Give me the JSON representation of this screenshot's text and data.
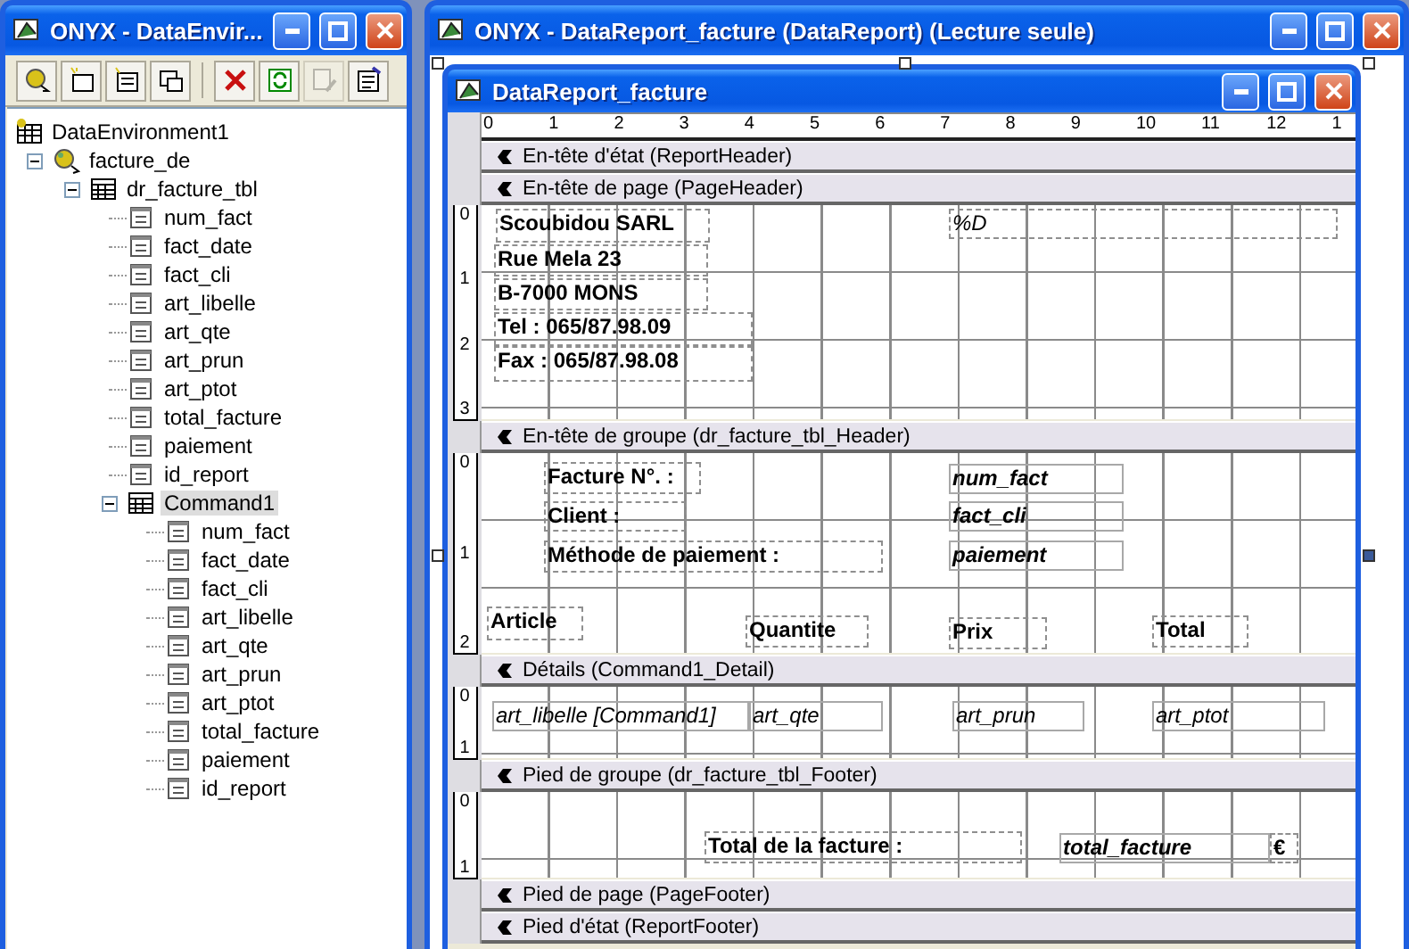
{
  "explorer": {
    "title": "ONYX - DataEnvir...",
    "toolbar": [
      {
        "kind": "connection",
        "disabled": false
      },
      {
        "kind": "command",
        "disabled": false
      },
      {
        "kind": "procedure",
        "disabled": false
      },
      {
        "kind": "child",
        "disabled": false
      },
      {
        "kind": "delete",
        "disabled": false
      },
      {
        "kind": "refresh",
        "disabled": false
      },
      {
        "kind": "design",
        "disabled": true
      },
      {
        "kind": "properties",
        "disabled": false
      }
    ],
    "tree": [
      {
        "label": "DataEnvironment1",
        "kind": "environment",
        "selected": false,
        "children": [
          {
            "label": "facture_de",
            "kind": "connection",
            "selected": false,
            "expanded": true,
            "children": [
              {
                "label": "dr_facture_tbl",
                "kind": "command",
                "selected": false,
                "expanded": true,
                "children": [
                  {
                    "label": "num_fact",
                    "kind": "field",
                    "selected": false
                  },
                  {
                    "label": "fact_date",
                    "kind": "field",
                    "selected": false
                  },
                  {
                    "label": "fact_cli",
                    "kind": "field",
                    "selected": false
                  },
                  {
                    "label": "art_libelle",
                    "kind": "field",
                    "selected": false
                  },
                  {
                    "label": "art_qte",
                    "kind": "field",
                    "selected": false
                  },
                  {
                    "label": "art_prun",
                    "kind": "field",
                    "selected": false
                  },
                  {
                    "label": "art_ptot",
                    "kind": "field",
                    "selected": false
                  },
                  {
                    "label": "total_facture",
                    "kind": "field",
                    "selected": false
                  },
                  {
                    "label": "paiement",
                    "kind": "field",
                    "selected": false
                  },
                  {
                    "label": "id_report",
                    "kind": "field",
                    "selected": false
                  },
                  {
                    "label": "Command1",
                    "kind": "command",
                    "selected": true,
                    "expanded": true,
                    "children": [
                      {
                        "label": "num_fact",
                        "kind": "field",
                        "selected": false
                      },
                      {
                        "label": "fact_date",
                        "kind": "field",
                        "selected": false
                      },
                      {
                        "label": "fact_cli",
                        "kind": "field",
                        "selected": false
                      },
                      {
                        "label": "art_libelle",
                        "kind": "field",
                        "selected": false
                      },
                      {
                        "label": "art_qte",
                        "kind": "field",
                        "selected": false
                      },
                      {
                        "label": "art_prun",
                        "kind": "field",
                        "selected": false
                      },
                      {
                        "label": "art_ptot",
                        "kind": "field",
                        "selected": false
                      },
                      {
                        "label": "total_facture",
                        "kind": "field",
                        "selected": false
                      },
                      {
                        "label": "paiement",
                        "kind": "field",
                        "selected": false
                      },
                      {
                        "label": "id_report",
                        "kind": "field",
                        "selected": false
                      }
                    ]
                  }
                ]
              }
            ]
          }
        ]
      }
    ]
  },
  "report": {
    "window_title": "ONYX - DataReport_facture (DataReport) (Lecture seule)",
    "designer_title": "DataReport_facture",
    "ruler": [
      "0",
      "1",
      "2",
      "3",
      "4",
      "5",
      "6",
      "7",
      "8",
      "9",
      "10",
      "11",
      "12",
      "1"
    ],
    "sections": [
      {
        "kind": "report_header",
        "title": "En-tête d'état (ReportHeader)"
      },
      {
        "kind": "page_header",
        "title": "En-tête de page (PageHeader)",
        "ruler": [
          "0",
          "1",
          "2",
          "3"
        ],
        "controls": [
          {
            "kind": "label",
            "text": "Scoubidou SARL",
            "bold": true,
            "italic": false
          },
          {
            "kind": "label",
            "text": "Rue Mela 23",
            "bold": true,
            "italic": false
          },
          {
            "kind": "label",
            "text": "B-7000   MONS",
            "bold": true,
            "italic": false
          },
          {
            "kind": "label",
            "text": "Tel : 065/87.98.09",
            "bold": true,
            "italic": false
          },
          {
            "kind": "label",
            "text": "Fax : 065/87.98.08",
            "bold": true,
            "italic": false
          },
          {
            "kind": "label",
            "text": "%D",
            "bold": false,
            "italic": true
          }
        ]
      },
      {
        "kind": "group_header",
        "title": "En-tête de groupe (dr_facture_tbl_Header)",
        "ruler": [
          "0",
          "1",
          "2"
        ],
        "controls": [
          {
            "kind": "label",
            "text": "Facture N°. :",
            "bold": true,
            "italic": false
          },
          {
            "kind": "label",
            "text": "Client :",
            "bold": true,
            "italic": false
          },
          {
            "kind": "label",
            "text": "Méthode de paiement :",
            "bold": true,
            "italic": false
          },
          {
            "kind": "field",
            "text": "num_fact",
            "bold": true,
            "italic": true
          },
          {
            "kind": "field",
            "text": "fact_cli",
            "bold": true,
            "italic": true
          },
          {
            "kind": "field",
            "text": "paiement",
            "bold": true,
            "italic": true
          },
          {
            "kind": "label",
            "text": "Article",
            "bold": true,
            "italic": false
          },
          {
            "kind": "label",
            "text": "Quantite",
            "bold": true,
            "italic": false
          },
          {
            "kind": "label",
            "text": "Prix",
            "bold": true,
            "italic": false
          },
          {
            "kind": "label",
            "text": "Total",
            "bold": true,
            "italic": false
          }
        ]
      },
      {
        "kind": "detail",
        "title": "Détails (Command1_Detail)",
        "ruler": [
          "0",
          "1"
        ],
        "controls": [
          {
            "kind": "field",
            "text": "art_libelle [Command1]",
            "bold": false,
            "italic": true
          },
          {
            "kind": "field",
            "text": "art_qte",
            "bold": false,
            "italic": true
          },
          {
            "kind": "field",
            "text": "art_prun",
            "bold": false,
            "italic": true
          },
          {
            "kind": "field",
            "text": "art_ptot",
            "bold": false,
            "italic": true
          }
        ]
      },
      {
        "kind": "group_footer",
        "title": "Pied de groupe (dr_facture_tbl_Footer)",
        "ruler": [
          "0",
          "1"
        ],
        "controls": [
          {
            "kind": "label",
            "text": "Total de la facture :",
            "bold": true,
            "italic": false
          },
          {
            "kind": "field",
            "text": "total_facture",
            "bold": true,
            "italic": true
          },
          {
            "kind": "label",
            "text": "€",
            "bold": true,
            "italic": false
          }
        ]
      },
      {
        "kind": "page_footer",
        "title": "Pied de page (PageFooter)"
      },
      {
        "kind": "report_footer",
        "title": "Pied d'état (ReportFooter)"
      }
    ]
  }
}
